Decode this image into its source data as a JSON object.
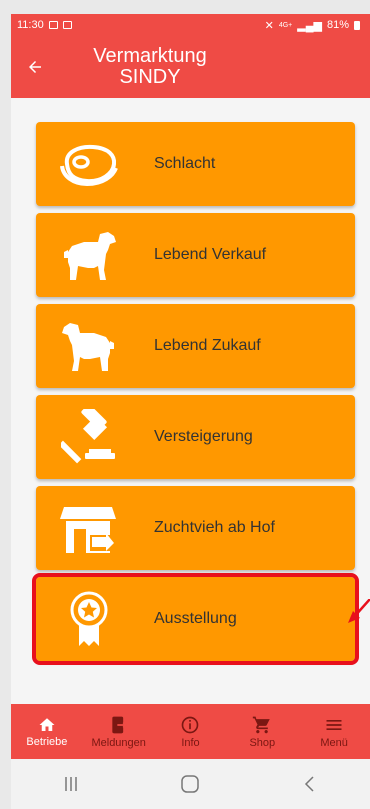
{
  "status": {
    "time": "11:30",
    "network": "4G+",
    "battery": "81%"
  },
  "header": {
    "line1": "Vermarktung",
    "line2": "SINDY"
  },
  "tiles": [
    {
      "label": "Schlacht",
      "icon": "steak-icon"
    },
    {
      "label": "Lebend Verkauf",
      "icon": "calf-icon"
    },
    {
      "label": "Lebend Zukauf",
      "icon": "calf-icon"
    },
    {
      "label": "Versteigerung",
      "icon": "gavel-icon"
    },
    {
      "label": "Zuchtvieh ab Hof",
      "icon": "barn-icon"
    },
    {
      "label": "Ausstellung",
      "icon": "award-ribbon-icon",
      "selected": true
    }
  ],
  "bottom_nav": [
    {
      "label": "Betriebe",
      "icon": "home-icon",
      "active": true
    },
    {
      "label": "Meldungen",
      "icon": "exit-icon"
    },
    {
      "label": "Info",
      "icon": "info-icon"
    },
    {
      "label": "Shop",
      "icon": "cart-icon"
    },
    {
      "label": "Menü",
      "icon": "menu-icon"
    }
  ],
  "colors": {
    "primary": "#ef4b45",
    "tile": "#ff9800",
    "highlight": "#e8101c"
  }
}
